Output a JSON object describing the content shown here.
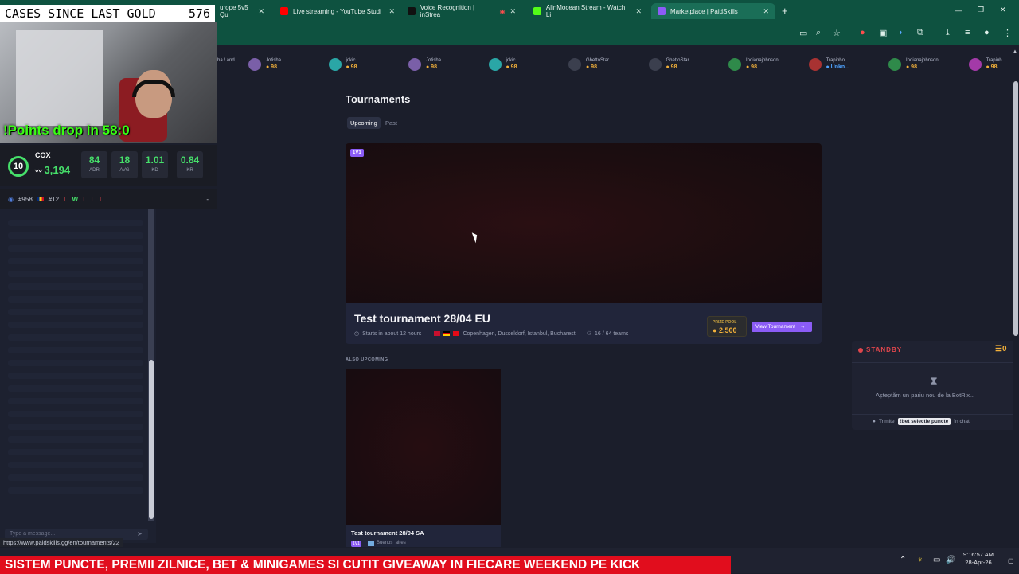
{
  "browser": {
    "tabs": [
      {
        "label": "urope 5v5 Qu",
        "icon_color": "#3aa0ff"
      },
      {
        "label": "Live streaming - YouTube Studi",
        "icon_color": "#ff0000"
      },
      {
        "label": "Voice Recognition | inStrea",
        "icon_color": "#111111"
      },
      {
        "label": "AlinMocean Stream - Watch Li",
        "icon_color": "#53fc18"
      },
      {
        "label": "Marketplace | PaidSkills",
        "icon_color": "#8b5cf6"
      }
    ],
    "new_tab": "+"
  },
  "overlay": {
    "cases_label": "CASES SINCE LAST GOLD",
    "cases_count": "576",
    "points_drop": "!Points drop in 58:0",
    "level": "10",
    "username": "COX___",
    "elo": "3,194",
    "stats": [
      {
        "value": "84",
        "label": "ADR"
      },
      {
        "value": "18",
        "label": "AVG"
      },
      {
        "value": "1.01",
        "label": "KD"
      },
      {
        "value": "0.84",
        "label": "KR"
      }
    ],
    "global_rank": "#958",
    "country_rank": "#12",
    "recent": [
      "L",
      "W",
      "L",
      "L",
      "L"
    ]
  },
  "chat": {
    "placeholder": "Type a message...",
    "status_url": "https://www.paidskills.gg/en/tournaments/22"
  },
  "players": [
    {
      "name": "...ha / and ...",
      "score": "",
      "color": "#8b3a3a"
    },
    {
      "name": "Jotisha",
      "score": "98",
      "color": "#7a5fa8"
    },
    {
      "name": "jokic",
      "score": "98",
      "color": "#2aa6a6"
    },
    {
      "name": "Jotisha",
      "score": "98",
      "color": "#7a5fa8"
    },
    {
      "name": "jokic",
      "score": "98",
      "color": "#2aa6a6"
    },
    {
      "name": "GhettoStar",
      "score": "98",
      "color": "#3b3f4e"
    },
    {
      "name": "GhettoStar",
      "score": "98",
      "color": "#3b3f4e"
    },
    {
      "name": "Indianajohnson",
      "score": "98",
      "color": "#2f8a4a"
    },
    {
      "name": "Trapinho",
      "score": "Unkn...",
      "color": "#a83232"
    },
    {
      "name": "Indianajohnson",
      "score": "98",
      "color": "#2f8a4a"
    },
    {
      "name": "Trapinh",
      "score": "98",
      "color": "#a33aa8"
    }
  ],
  "main": {
    "title": "Tournaments",
    "tabs": [
      "Upcoming",
      "Past"
    ],
    "hero": {
      "badge": "1V1",
      "name": "Test tournament 28/04 EU",
      "starts": "Starts in about 12 hours",
      "locations": "Copenhagen, Dusseldorf, Istanbul, Bucharest",
      "teams": "16 / 64 teams",
      "prize_label": "PRIZE POOL",
      "prize_value": "2.500",
      "view_button": "View Tournament"
    },
    "also_label": "ALSO UPCOMING",
    "card2": {
      "name": "Test tournament 28/04 SA",
      "badge": "1V1",
      "location": "Buenos_aires"
    }
  },
  "botrix": {
    "status": "STANDBY",
    "coins": "0",
    "message": "Așteptăm un pariu nou de la BotRix...",
    "footer_prefix": "Trimite",
    "command": "!bet selectie puncte",
    "footer_suffix": "în chat"
  },
  "taskbar": {
    "time": "9:16:57 AM",
    "date": "28-Apr-26"
  },
  "banner": "SISTEM PUNCTE, PREMII ZILNICE, BET & MINIGAMES SI CUTIT GIVEAWAY IN FIECARE WEEKEND PE KICK"
}
